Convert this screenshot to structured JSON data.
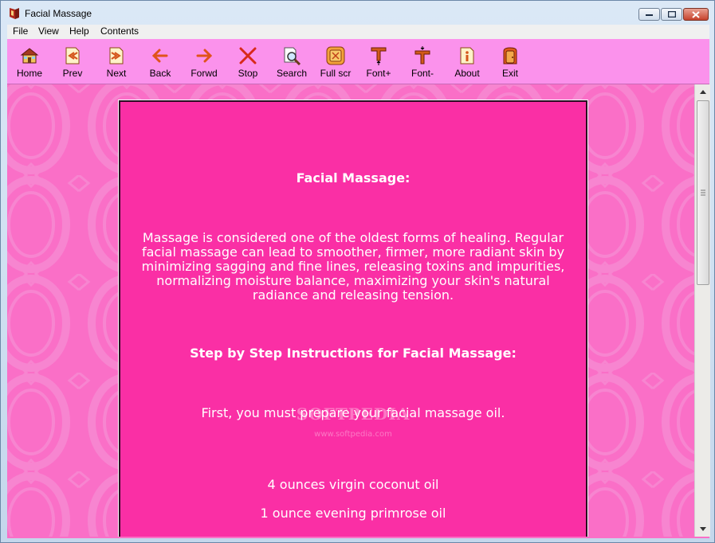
{
  "window": {
    "title": "Facial Massage"
  },
  "menu": [
    "File",
    "View",
    "Help",
    "Contents"
  ],
  "toolbar": [
    {
      "label": "Home",
      "icon": "home-icon"
    },
    {
      "label": "Prev",
      "icon": "prev-icon"
    },
    {
      "label": "Next",
      "icon": "next-icon"
    },
    {
      "label": "Back",
      "icon": "back-arrow-icon"
    },
    {
      "label": "Forwd",
      "icon": "forward-arrow-icon"
    },
    {
      "label": "Stop",
      "icon": "stop-icon"
    },
    {
      "label": "Search",
      "icon": "search-icon"
    },
    {
      "label": "Full scr",
      "icon": "fullscreen-icon"
    },
    {
      "label": "Font+",
      "icon": "font-increase-icon"
    },
    {
      "label": "Font-",
      "icon": "font-decrease-icon"
    },
    {
      "label": "About",
      "icon": "about-icon"
    },
    {
      "label": "Exit",
      "icon": "exit-icon"
    }
  ],
  "content": {
    "heading1": "Facial Massage:",
    "para1": "Massage is considered one of the oldest forms of healing. Regular facial massage can lead to smoother, firmer, more radiant skin by minimizing sagging and fine lines, releasing toxins and impurities, normalizing moisture balance, maximizing your skin's natural radiance and releasing tension.",
    "heading2": "Step by Step Instructions for Facial Massage:",
    "para2": "First, you must prepare your facial massage oil.",
    "ingredient1": "4 ounces virgin coconut oil",
    "ingredient2": "1 ounce evening primrose oil"
  },
  "watermark": {
    "brand": "SOFTPEDIA",
    "url": "www.softpedia.com"
  },
  "colors": {
    "toolbar": "#fb92ec",
    "background": "#fa6fc7",
    "page": "#fa2fa5",
    "text": "#ffffff"
  }
}
